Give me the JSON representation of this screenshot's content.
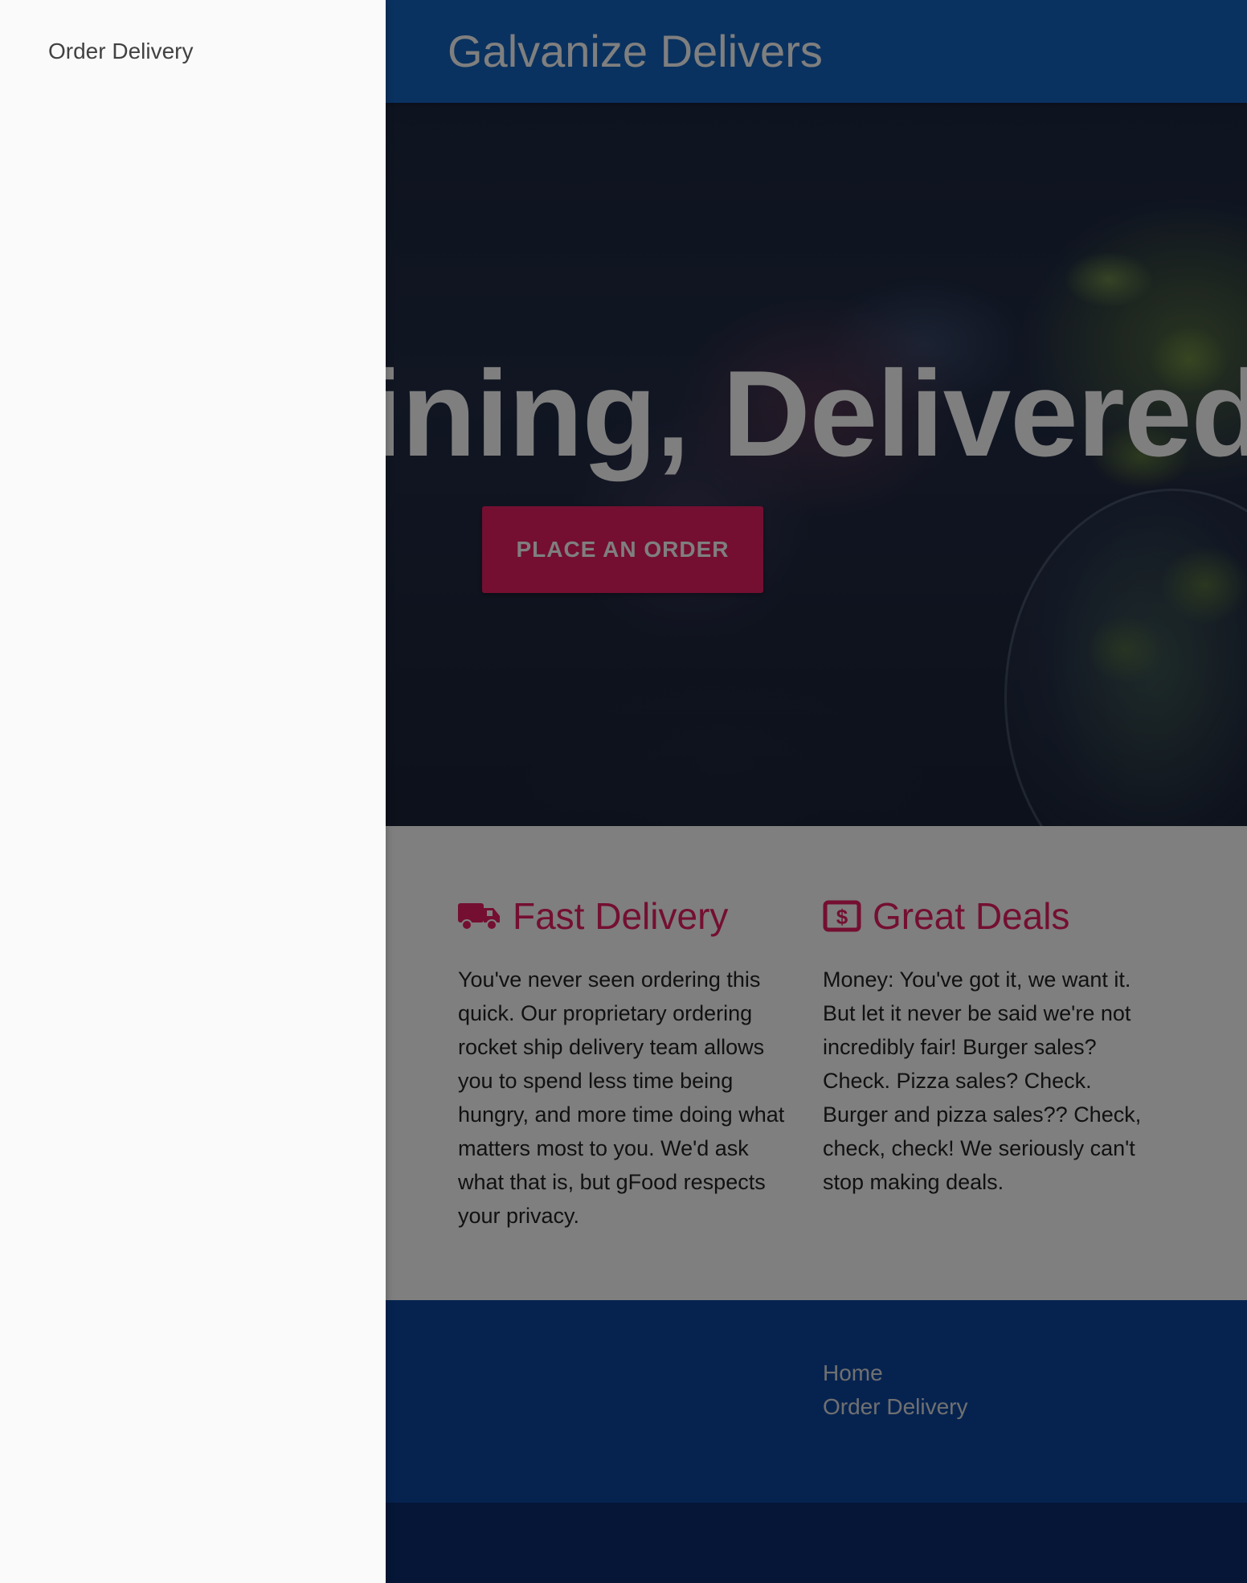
{
  "navbar": {
    "brand": "Galvanize Delivers"
  },
  "hero": {
    "headline": "Fine Dining, Delivered.",
    "cta_label": "PLACE AN ORDER"
  },
  "features": [
    {
      "title": "Fast Delivery",
      "icon": "truck-icon",
      "body": "You've never seen ordering this quick. Our proprietary ordering rocket ship delivery team allows you to spend less time being hungry, and more time doing what matters most to you. We'd ask what that is, but gFood respects your privacy."
    },
    {
      "title": "Great Deals",
      "icon": "dollar-bill-icon",
      "body": "Money: You've got it, we want it. But let it never be said we're not incredibly fair! Burger sales? Check. Pizza sales? Check. Burger and pizza sales?? Check, check, check! We seriously can't stop making deals."
    }
  ],
  "footer": {
    "links": [
      "Home",
      "Order Delivery"
    ]
  },
  "drawer": {
    "items": [
      "Order Delivery"
    ]
  },
  "colors": {
    "primary": "#1565c0",
    "accent": "#e91e63",
    "footer": "#0d47a1",
    "footer_bottom": "#0b2d6e",
    "drawer": "#fafafa"
  }
}
